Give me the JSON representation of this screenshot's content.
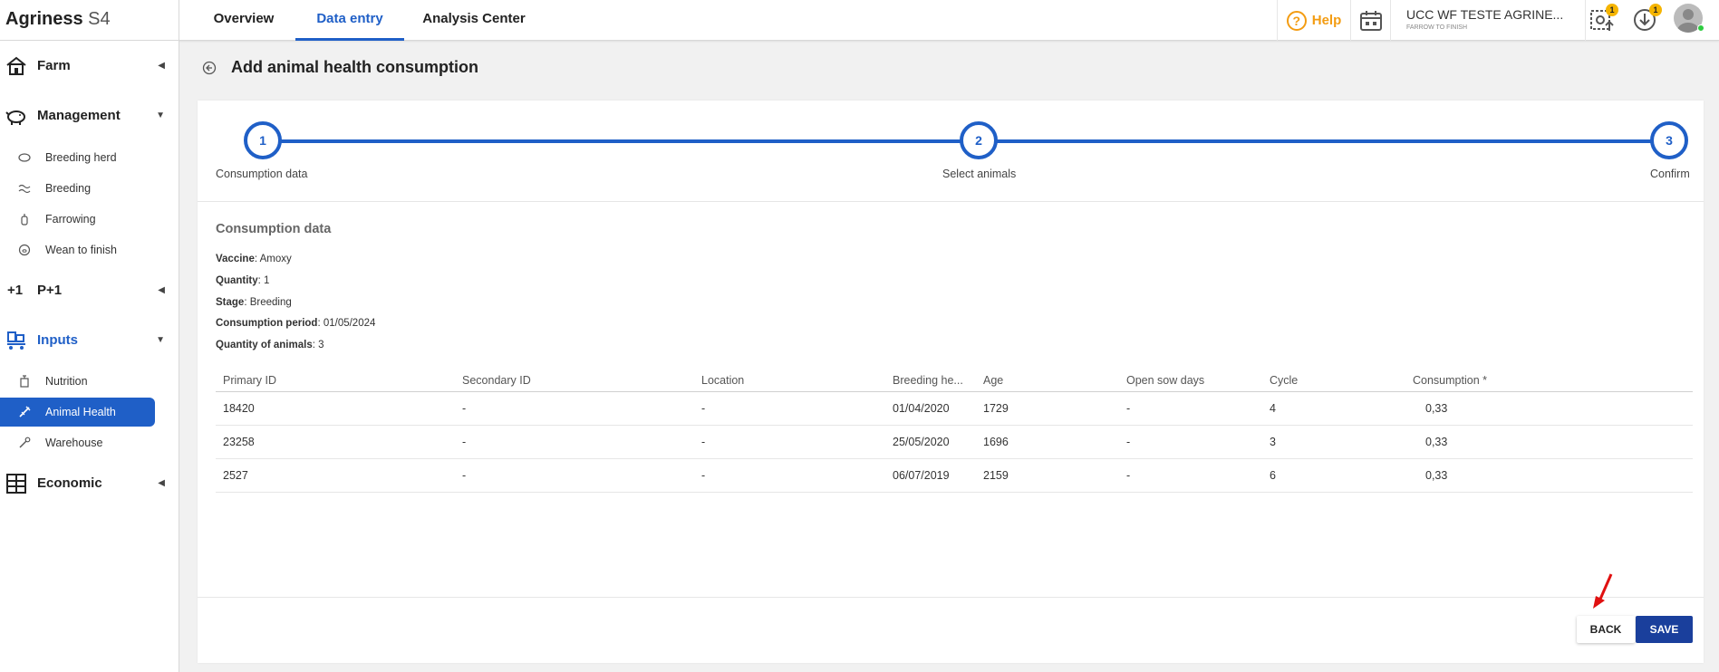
{
  "app": {
    "name_bold": "Agriness",
    "name_thin": "S4"
  },
  "top_tabs": [
    {
      "label": "Overview"
    },
    {
      "label": "Data entry"
    },
    {
      "label": "Analysis Center"
    }
  ],
  "header": {
    "help_label": "Help",
    "help_icon": "?",
    "farm_name": "UCC WF TESTE AGRINE...",
    "farm_subtitle": "FARROW TO FINISH",
    "notifications_count": "1",
    "downloads_count": "1"
  },
  "sidebar": {
    "sections": [
      {
        "label": "Farm",
        "arrow": "◀"
      },
      {
        "label": "Management",
        "arrow": "▼"
      },
      {
        "label": "P+1",
        "arrow": "◀",
        "icon_text": "+1"
      },
      {
        "label": "Inputs",
        "arrow": "▼"
      },
      {
        "label": "Economic",
        "arrow": "◀"
      }
    ],
    "management_items": [
      {
        "label": "Breeding herd"
      },
      {
        "label": "Breeding"
      },
      {
        "label": "Farrowing"
      },
      {
        "label": "Wean to finish"
      }
    ],
    "inputs_items": [
      {
        "label": "Nutrition"
      },
      {
        "label": "Animal Health"
      },
      {
        "label": "Warehouse"
      }
    ]
  },
  "page": {
    "title": "Add animal health consumption"
  },
  "stepper": {
    "steps": [
      {
        "number": "1",
        "label": "Consumption data"
      },
      {
        "number": "2",
        "label": "Select animals"
      },
      {
        "number": "3",
        "label": "Confirm"
      }
    ]
  },
  "summary": {
    "title": "Consumption data",
    "fields": [
      {
        "key": "Vaccine",
        "value": "Amoxy"
      },
      {
        "key": "Quantity",
        "value": "1"
      },
      {
        "key": "Stage",
        "value": "Breeding"
      },
      {
        "key": "Consumption period",
        "value": "01/05/2024"
      },
      {
        "key": "Quantity of animals",
        "value": "3"
      }
    ]
  },
  "table": {
    "headers": [
      "Primary ID",
      "Secondary ID",
      "Location",
      "Breeding he...",
      "Age",
      "Open sow days",
      "Cycle",
      "Consumption *"
    ],
    "rows": [
      [
        "18420",
        "-",
        "-",
        "01/04/2020",
        "1729",
        "-",
        "4",
        "0,33"
      ],
      [
        "23258",
        "-",
        "-",
        "25/05/2020",
        "1696",
        "-",
        "3",
        "0,33"
      ],
      [
        "2527",
        "-",
        "-",
        "06/07/2019",
        "2159",
        "-",
        "6",
        "0,33"
      ]
    ]
  },
  "buttons": {
    "back": "BACK",
    "save": "SAVE"
  },
  "colors": {
    "accent": "#1f5fc7",
    "save_button": "#1a3f9c",
    "help": "#f39c12",
    "badge": "#f5b400",
    "annotation": "#e01010"
  }
}
